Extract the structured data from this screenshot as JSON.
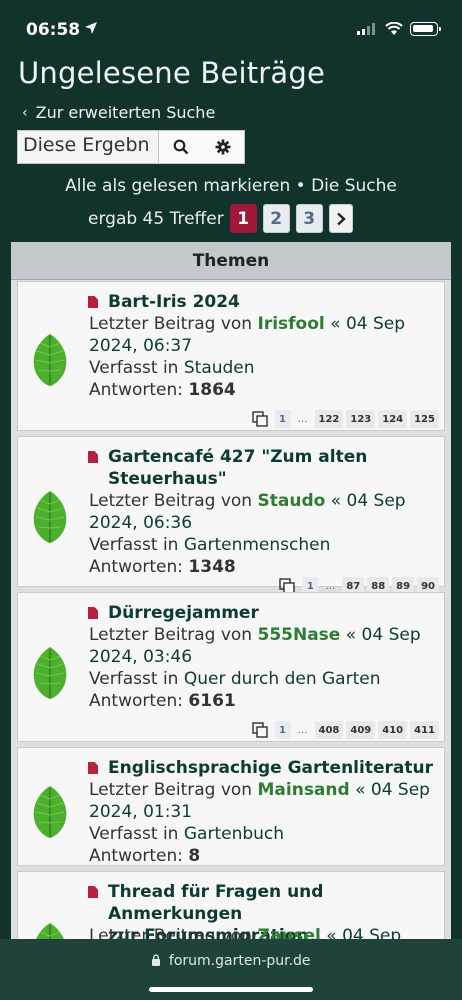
{
  "status": {
    "time": "06:58"
  },
  "header": {
    "title": "Ungelesene Beiträge",
    "back_label": "Zur erweiterten Suche"
  },
  "search": {
    "value": "Diese Ergebn"
  },
  "actions": {
    "mark_read": "Alle als gelesen markieren",
    "separator": "•",
    "result_part1": "Die Suche",
    "result_part2": "ergab 45 Treffer"
  },
  "pagination": {
    "pages": [
      "1",
      "2",
      "3"
    ],
    "current": "1"
  },
  "list": {
    "header": "Themen",
    "topics": [
      {
        "title_lines": [
          "Bart-Iris 2024"
        ],
        "last_post_prefix": "Letzter Beitrag von",
        "user": "Irisfool",
        "date_a": "« 04 Sep",
        "date_b": "2024, 06:37",
        "forum_prefix": "Verfasst in",
        "forum": "Stauden",
        "replies_label": "Antworten:",
        "replies": "1864",
        "pages": [
          "1",
          "…",
          "122",
          "123",
          "124",
          "125"
        ]
      },
      {
        "title_lines": [
          "Gartencafé 427 \"Zum alten",
          "Steuerhaus\""
        ],
        "last_post_prefix": "Letzter Beitrag von",
        "user": "Staudo",
        "date_a": "« 04 Sep",
        "date_b": "2024, 06:36",
        "forum_prefix": "Verfasst in",
        "forum": "Gartenmenschen",
        "replies_label": "Antworten:",
        "replies": "1348",
        "pages": [
          "1",
          "…",
          "87",
          "88",
          "89",
          "90"
        ]
      },
      {
        "title_lines": [
          "Dürregejammer"
        ],
        "last_post_prefix": "Letzter Beitrag von",
        "user": "555Nase",
        "date_a": "« 04 Sep",
        "date_b": "2024, 03:46",
        "forum_prefix": "Verfasst in",
        "forum": "Quer durch den Garten",
        "replies_label": "Antworten:",
        "replies": "6161",
        "pages": [
          "1",
          "…",
          "408",
          "409",
          "410",
          "411"
        ]
      },
      {
        "title_lines": [
          "Englischsprachige Gartenliteratur"
        ],
        "last_post_prefix": "Letzter Beitrag von",
        "user": "Mainsand",
        "date_a": "« 04 Sep",
        "date_b": "2024, 01:31",
        "forum_prefix": "Verfasst in",
        "forum": "Gartenbuch",
        "replies_label": "Antworten:",
        "replies": "8",
        "pages": []
      },
      {
        "title_lines": [
          "Thread für Fragen und Anmerkungen",
          "zur Forumsmigration"
        ],
        "last_post_prefix": "Letzter Beitrag von",
        "user": "Zausel",
        "date_a": "« 04 Sep",
        "date_b": "",
        "forum_prefix": "",
        "forum": "",
        "replies_label": "",
        "replies": "",
        "pages": []
      }
    ]
  },
  "browser": {
    "url": "forum.garten-pur.de"
  }
}
